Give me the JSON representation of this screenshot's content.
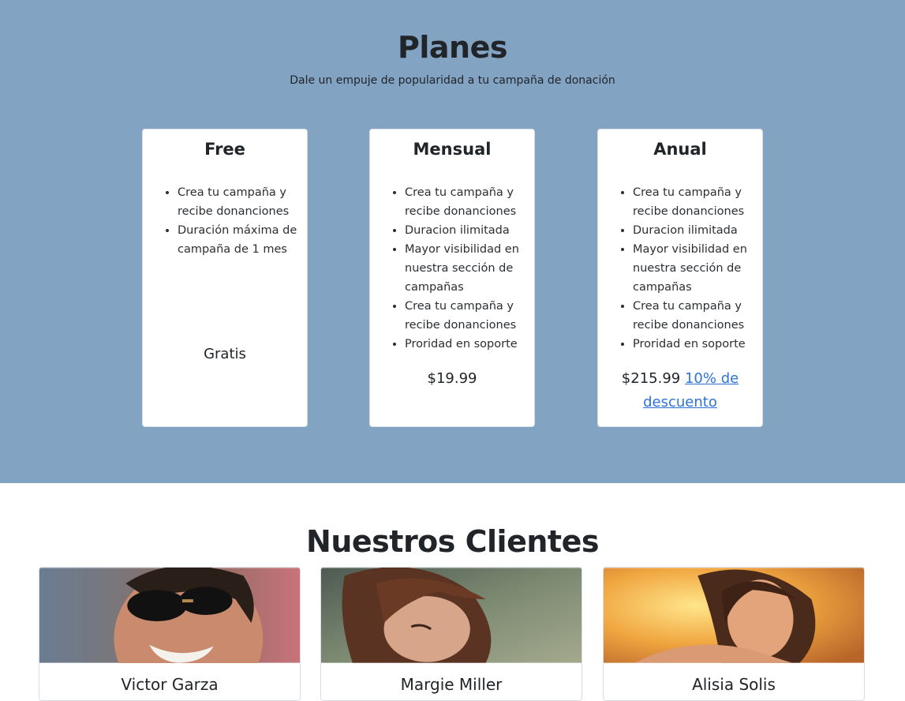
{
  "plans": {
    "title": "Planes",
    "subtitle": "Dale un empuje de popularidad a tu campaña de donación",
    "cards": [
      {
        "title": "Free",
        "features": [
          "Crea tu campaña y recibe donanciones",
          "Duración máxima de campaña de 1 mes"
        ],
        "price": "Gratis"
      },
      {
        "title": "Mensual",
        "features": [
          "Crea tu campaña y recibe donanciones",
          "Duracion ilimitada",
          "Mayor visibilidad en nuestra sección de campañas",
          "Crea tu campaña y recibe donanciones",
          "Proridad en soporte"
        ],
        "price": "$19.99"
      },
      {
        "title": "Anual",
        "features": [
          "Crea tu campaña y recibe donanciones",
          "Duracion ilimitada",
          "Mayor visibilidad en nuestra sección de campañas",
          "Crea tu campaña y recibe donanciones",
          "Proridad en soporte"
        ],
        "price": "$215.99",
        "discount_link": "10% de descuento"
      }
    ]
  },
  "clients": {
    "title": "Nuestros Clientes",
    "items": [
      {
        "name": "Victor Garza"
      },
      {
        "name": "Margie Miller"
      },
      {
        "name": "Alisia Solis"
      }
    ]
  },
  "colors": {
    "plans_background": "#83a3c3",
    "link": "#2f72d8"
  }
}
